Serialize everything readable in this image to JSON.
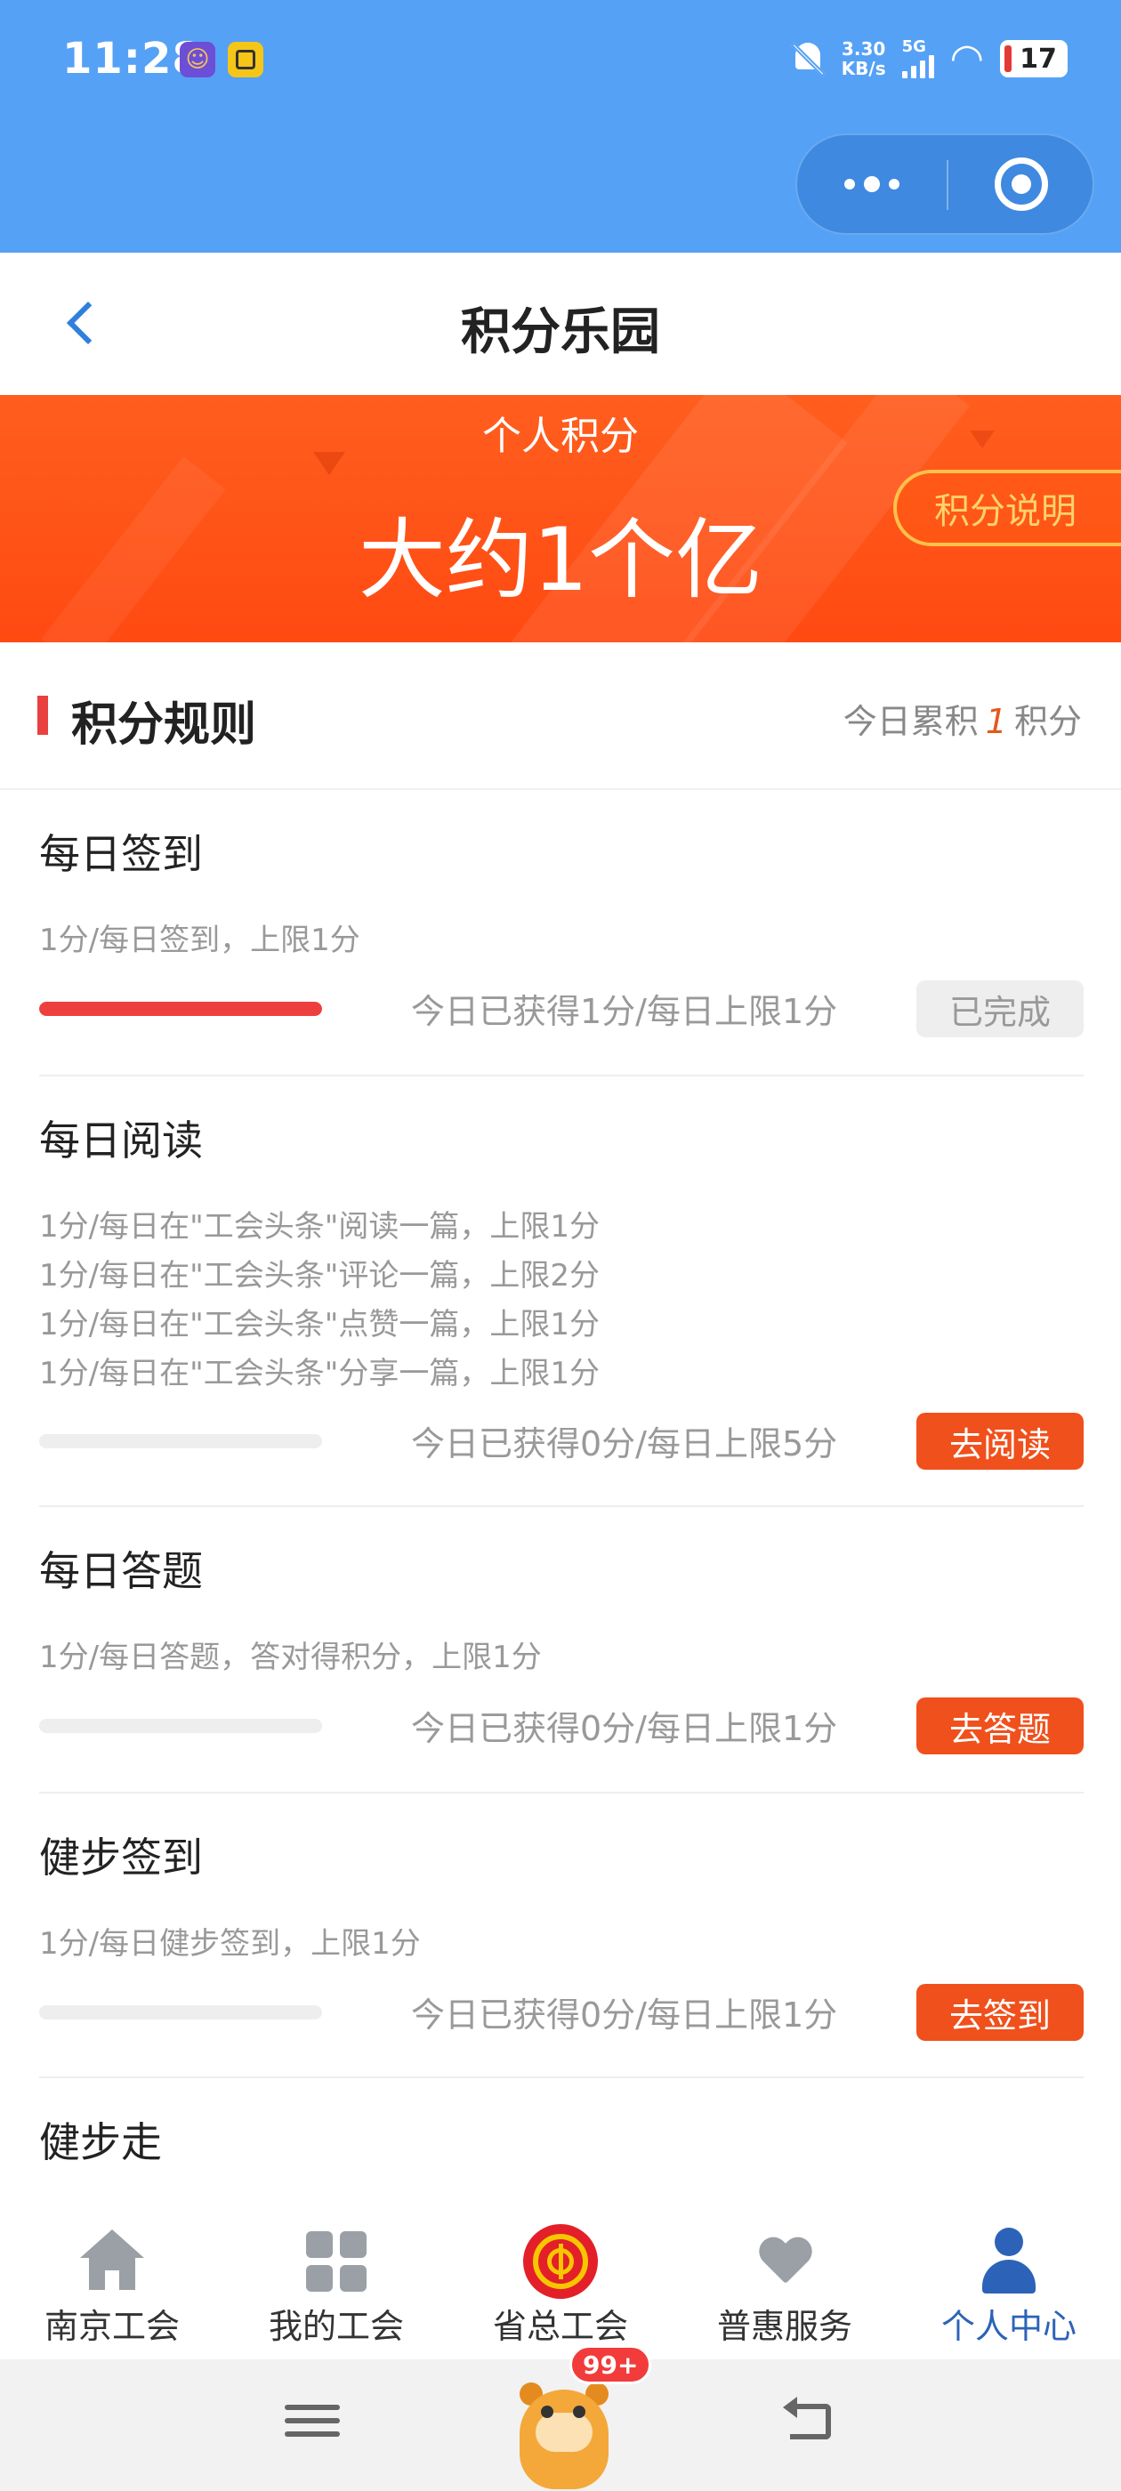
{
  "status_bar": {
    "time": "11:28",
    "net_speed_value": "3.30",
    "net_speed_unit": "KB/s",
    "network": "5G",
    "battery": "17",
    "icons": [
      "bell-off-icon",
      "signal-icon",
      "wifi-icon",
      "battery-icon"
    ]
  },
  "header": {
    "title": "积分乐园",
    "back_icon": "chevron-left-icon",
    "capsule_icons": [
      "more-dots-icon",
      "close-target-icon"
    ]
  },
  "banner": {
    "label": "个人积分",
    "value": "大约1个亿",
    "explain_button": "积分说明"
  },
  "rules": {
    "title": "积分规则",
    "today_prefix": "今日累积",
    "today_value": "1",
    "today_suffix": "积分"
  },
  "tasks": [
    {
      "name": "每日签到",
      "desc": [
        "1分/每日签到，上限1分"
      ],
      "earned": "今日已获得1分/每日上限1分",
      "progress": 1.0,
      "button": "已完成",
      "button_state": "done"
    },
    {
      "name": "每日阅读",
      "desc": [
        "1分/每日在\"工会头条\"阅读一篇，上限1分",
        "1分/每日在\"工会头条\"评论一篇，上限2分",
        "1分/每日在\"工会头条\"点赞一篇，上限1分",
        "1分/每日在\"工会头条\"分享一篇，上限1分"
      ],
      "earned": "今日已获得0分/每日上限5分",
      "progress": 0.0,
      "button": "去阅读",
      "button_state": "go"
    },
    {
      "name": "每日答题",
      "desc": [
        "1分/每日答题，答对得积分，上限1分"
      ],
      "earned": "今日已获得0分/每日上限1分",
      "progress": 0.0,
      "button": "去答题",
      "button_state": "go"
    },
    {
      "name": "健步签到",
      "desc": [
        "1分/每日健步签到，上限1分"
      ],
      "earned": "今日已获得0分/每日上限1分",
      "progress": 0.0,
      "button": "去签到",
      "button_state": "go"
    },
    {
      "name": "健步走"
    }
  ],
  "tabbar": {
    "items": [
      {
        "label": "南京工会",
        "icon": "home-icon",
        "active": false
      },
      {
        "label": "我的工会",
        "icon": "grid-icon",
        "active": false
      },
      {
        "label": "省总工会",
        "icon": "union-emblem-icon",
        "active": false
      },
      {
        "label": "普惠服务",
        "icon": "heart-icon",
        "active": false
      },
      {
        "label": "个人中心",
        "icon": "person-icon",
        "active": true
      }
    ]
  },
  "navbar": {
    "badge": "99+",
    "icons": [
      "menu-icon",
      "mascot-icon",
      "back-icon"
    ]
  },
  "colors": {
    "status_blue": "#55A1F5",
    "banner_orange": "#FF4A12",
    "accent_red": "#EE3F3F",
    "button_orange": "#F0501C",
    "active_tab_blue": "#2C63B8"
  }
}
